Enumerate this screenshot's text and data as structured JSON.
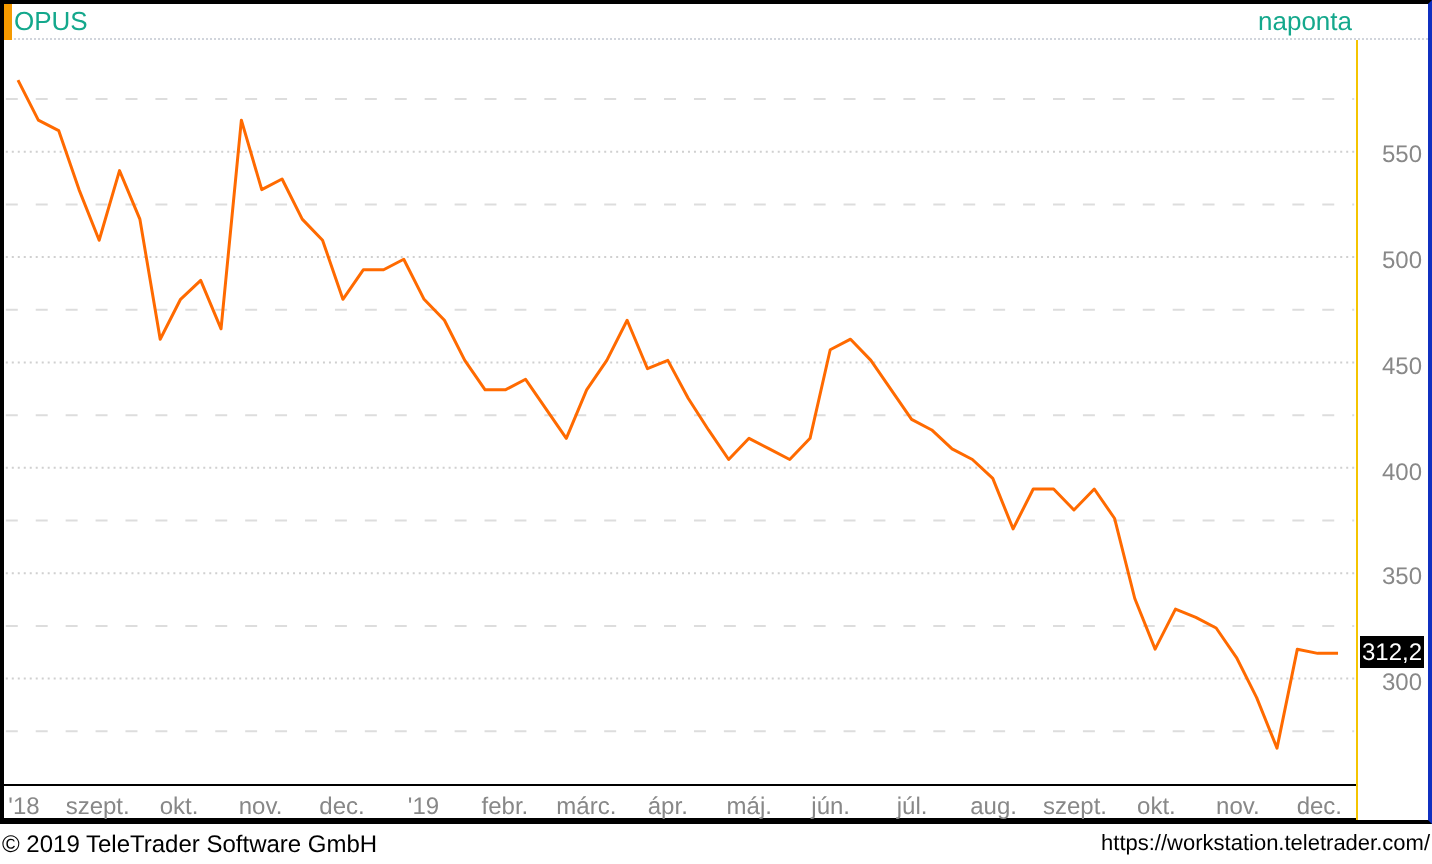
{
  "header": {
    "interval": "naponta"
  },
  "chart": {
    "chart_data": {
      "type": "line",
      "grid": true,
      "ylim": [
        250,
        603
      ],
      "yticks": [
        300,
        350,
        400,
        450,
        500,
        550
      ],
      "categories": [
        "'18",
        null,
        null,
        null,
        "szept.",
        null,
        null,
        null,
        "okt.",
        null,
        null,
        null,
        "nov.",
        null,
        null,
        null,
        "dec.",
        null,
        null,
        null,
        "'19",
        null,
        null,
        null,
        "febr.",
        null,
        null,
        null,
        "márc.",
        null,
        null,
        null,
        "ápr.",
        null,
        null,
        null,
        "máj.",
        null,
        null,
        null,
        "jún.",
        null,
        null,
        null,
        "júl.",
        null,
        null,
        null,
        "aug.",
        null,
        null,
        null,
        "szept.",
        null,
        null,
        null,
        "okt.",
        null,
        null,
        null,
        "nov.",
        null,
        null,
        null,
        "dec.",
        null
      ],
      "series": [
        {
          "name": "OPUS",
          "color": "#ff6a00",
          "values": [
            584,
            565,
            560,
            532,
            508,
            541,
            518,
            461,
            480,
            489,
            466,
            565,
            532,
            537,
            518,
            508,
            480,
            494,
            494,
            499,
            480,
            470,
            451,
            437,
            437,
            442,
            428,
            414,
            437,
            451,
            470,
            447,
            451,
            433,
            418,
            404,
            414,
            409,
            404,
            414,
            456,
            461,
            451,
            437,
            423,
            418,
            409,
            404,
            395,
            371,
            390,
            390,
            380,
            390,
            376,
            338,
            314,
            333,
            329,
            324,
            310,
            291,
            267,
            314,
            312,
            312
          ]
        }
      ]
    }
  },
  "last_price": "312,2",
  "footer": {
    "copyright": "© 2019 TeleTrader Software GmbH",
    "url": "https://workstation.teletrader.com/"
  }
}
